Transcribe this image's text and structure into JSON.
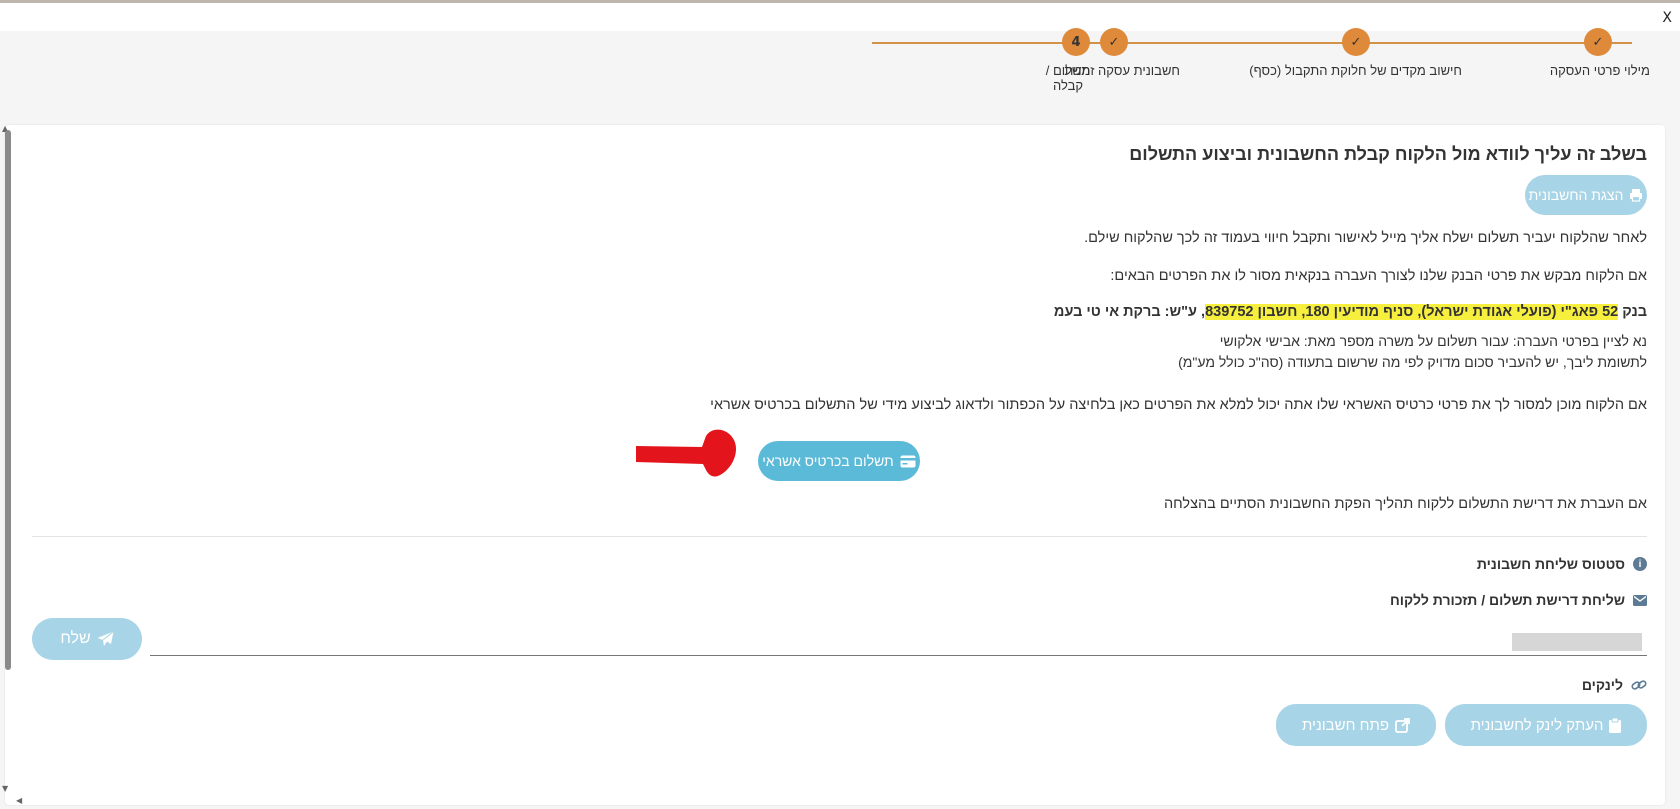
{
  "window": {
    "close_label": "X"
  },
  "stepper": {
    "steps": [
      {
        "label": "מילוי פרטי העסקה",
        "state": "done",
        "mark": "✓"
      },
      {
        "label": "חישוב מקדים של חלוקת התקבול (כסף)",
        "state": "done",
        "mark": "✓"
      },
      {
        "label": "חשבונית עסקה זמנית",
        "state": "done",
        "mark": "✓"
      },
      {
        "label_line1": "תשלום /",
        "label_line2": "קבלה",
        "state": "current",
        "mark": "4"
      }
    ],
    "accent": "#df8a3b"
  },
  "main": {
    "heading": "בשלב זה עליך לוודא מול הלקוח קבלת החשבונית וביצוע התשלום",
    "invoice_button": "הצגת החשבונית",
    "para1": "לאחר שהלקוח יעביר תשלום ישלח אליך מייל לאישור ותקבל חיווי בעמוד זה לכך שהלקוח שילם.",
    "para2": "אם הלקוח מבקש את פרטי הבנק שלנו לצורך העברה בנקאית מסור לו את הפרטים הבאים:",
    "bank_prefix": "בנק",
    "bank_details": "52 פאג\"י (פועלי אגודת ישראל), סניף מודיעין 180, חשבון 839752",
    "bank_suffix": ", ע\"ש: ברקת אי טי בעמ",
    "note1": "נא לציין בפרטי העברה: עבור תשלום על משרה מספר מאת: אבישי אלקושי",
    "note2": "לתשומת ליבך, יש להעביר סכום מדויק לפי מה שרשום בתעודה (סה\"כ כולל מע\"מ)",
    "para3": "אם הלקוח מוכן למסור לך את פרטי כרטיס האשראי שלו אתה יכול למלא את הפרטים כאן בלחיצה על הכפתור ולדאוג לביצוע מידי של התשלום בכרטיס אשראי",
    "cc_button": "תשלום בכרטיס אשראי",
    "para4": "אם העברת את דרישת התשלום ללקוח תהליך הפקת החשבונית הסתיים בהצלחה",
    "highlight_color": "#f7ef3e",
    "button_color": "#a7d4e6",
    "button_active_color": "#5bbad8"
  },
  "status": {
    "invoice_status_title": "סטטוס שליחת חשבונית",
    "send_title": "שליחת דרישת תשלום / תזכורת ללקוח",
    "input_value": "",
    "send_button": "שלח"
  },
  "links": {
    "title": "לינקים",
    "copy_button": "העתק לינק לחשבונית",
    "open_button": "פתח חשבונית"
  }
}
